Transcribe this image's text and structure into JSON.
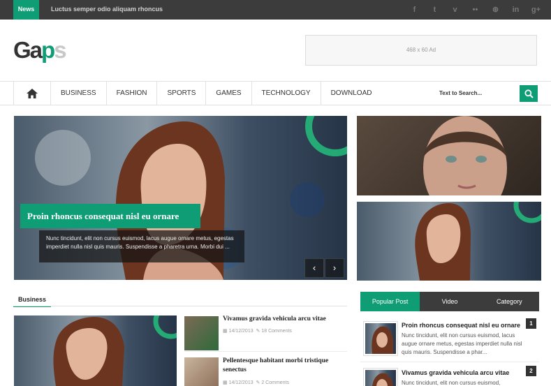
{
  "topbar": {
    "news_label": "News",
    "ticker_text": "Luctus semper odio aliquam rhoncus",
    "socials": [
      {
        "icon": "facebook-icon",
        "glyph": "f"
      },
      {
        "icon": "twitter-icon",
        "glyph": "t"
      },
      {
        "icon": "vimeo-icon",
        "glyph": "v"
      },
      {
        "icon": "flickr-icon",
        "glyph": "••"
      },
      {
        "icon": "dribbble-icon",
        "glyph": "⊛"
      },
      {
        "icon": "linkedin-icon",
        "glyph": "in"
      },
      {
        "icon": "googleplus-icon",
        "glyph": "g+"
      }
    ]
  },
  "header": {
    "logo": {
      "part1": "Ga",
      "part2": "p",
      "part3": "s"
    },
    "ad_text": "468 x 60 Ad"
  },
  "nav": {
    "items": [
      "BUSINESS",
      "FASHION",
      "SPORTS",
      "GAMES",
      "TECHNOLOGY",
      "DOWNLOAD"
    ],
    "search_placeholder": "Text to Search..."
  },
  "slider": {
    "title": "Proin rhoncus consequat nisl eu ornare",
    "excerpt": "Nunc tincidunt, elit non cursus euismod, lacus augue ornare metus, egestas imperdiet nulla nisl quis mauris. Suspendisse a pharetra urna. Morbi dui ...",
    "prev": "‹",
    "next": "›"
  },
  "business": {
    "section_title": "Business",
    "posts": [
      {
        "title": "Vivamus gravida vehicula arcu vitae",
        "date": "14/12/2013",
        "comments": "18 Comments"
      },
      {
        "title": "Pellentesque habitant morbi tristique senectus",
        "date": "14/12/2013",
        "comments": "2 Comments"
      }
    ]
  },
  "sidebar": {
    "tabs": [
      "Popular Post",
      "Video",
      "Category"
    ],
    "popular": [
      {
        "number": "1",
        "title": "Proin rhoncus consequat nisl eu ornare",
        "text": "Nunc tincidunt, elit non cursus euismod, lacus augue ornare metus, egestas imperdiet nulla nisl quis mauris. Suspendisse a phar..."
      },
      {
        "number": "2",
        "title": "Vivamus gravida vehicula arcu vitae",
        "text": "Nunc tincidunt, elit non cursus euismod,"
      }
    ]
  },
  "colors": {
    "accent": "#0f9d76",
    "topbar": "#3c3c3c"
  }
}
